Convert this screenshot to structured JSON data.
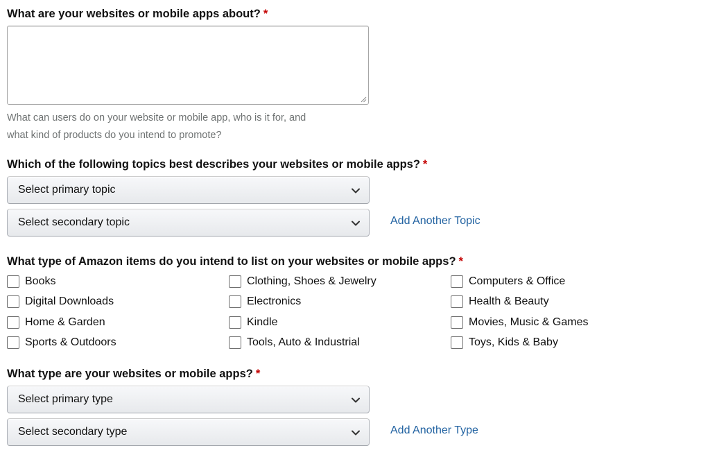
{
  "required_marker": "*",
  "about": {
    "label": "What are your websites or mobile apps about?",
    "value": "",
    "hint_line1": "What can users do on your website or mobile app, who is it for, and",
    "hint_line2": "what kind of products do you intend to promote?"
  },
  "topics": {
    "label": "Which of the following topics best describes your websites or mobile apps?",
    "primary": "Select primary topic",
    "secondary": "Select secondary topic",
    "add_link": "Add Another Topic"
  },
  "items": {
    "label": "What type of Amazon items do you intend to list on your websites or mobile apps?",
    "options": [
      {
        "label": "Books",
        "checked": false
      },
      {
        "label": "Clothing, Shoes & Jewelry",
        "checked": false
      },
      {
        "label": "Computers & Office",
        "checked": false
      },
      {
        "label": "Digital Downloads",
        "checked": false
      },
      {
        "label": "Electronics",
        "checked": false
      },
      {
        "label": "Health & Beauty",
        "checked": false
      },
      {
        "label": "Home & Garden",
        "checked": false
      },
      {
        "label": "Kindle",
        "checked": false
      },
      {
        "label": "Movies, Music & Games",
        "checked": false
      },
      {
        "label": "Sports & Outdoors",
        "checked": false
      },
      {
        "label": "Tools, Auto & Industrial",
        "checked": false
      },
      {
        "label": "Toys, Kids & Baby",
        "checked": false
      }
    ]
  },
  "types": {
    "label": "What type are your websites or mobile apps?",
    "primary": "Select primary type",
    "secondary": "Select secondary type",
    "add_link": "Add Another Type"
  },
  "colors": {
    "required": "#c40000",
    "link": "#2162a1",
    "hint": "#6f7373"
  },
  "icons": {
    "dropdown": "chevron-down-icon",
    "resize": "resize-grip-icon",
    "checkbox": "checkbox-unchecked"
  }
}
